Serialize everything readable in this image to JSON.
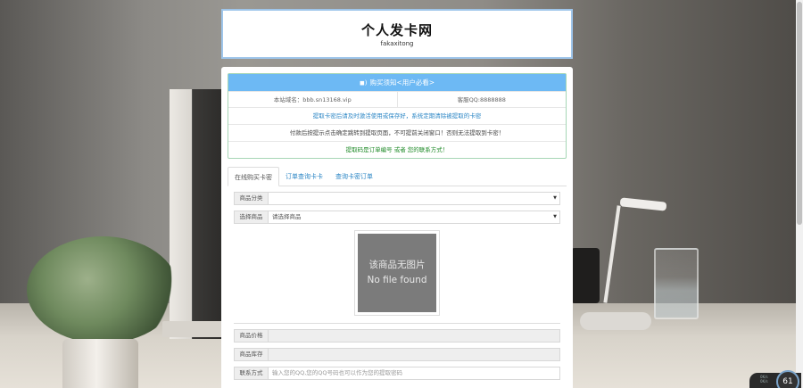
{
  "header": {
    "title": "个人发卡网",
    "subtitle": "fakaxitong"
  },
  "notice": {
    "title_icon": "speaker-icon",
    "title": "购买须知<用户必看>",
    "site_domain": "本站域名：bbb.sn13168.vip",
    "support_qq": "客服QQ:8888888",
    "line1": "提取卡密后请及时激活使用或保存好，系统定期清除被提取的卡密",
    "line2": "付款后按提示点击确定跳转到提取页面，不可提前关闭窗口！否则无法提取到卡密！",
    "line3": "提取码是订单编号 或者 您的联系方式！"
  },
  "tabs": [
    {
      "label": "在线购买卡密"
    },
    {
      "label": "订单查询卡卡"
    },
    {
      "label": "查询卡密订单"
    }
  ],
  "form": {
    "category_label": "商品分类",
    "category_value": "",
    "product_label": "选择商品",
    "product_value": "请选择商品",
    "price_label": "商品价格",
    "price_value": "",
    "stock_label": "商品库存",
    "stock_value": "",
    "contact_label": "联系方式",
    "contact_placeholder": "输入您的QQ,您的QQ号码也可以作为您的提取密码"
  },
  "product_image": {
    "line1": "该商品无图片",
    "line2": "No file found"
  },
  "widget": {
    "speed_up": "0K/s",
    "speed_down": "0K/s",
    "percent": "61"
  }
}
